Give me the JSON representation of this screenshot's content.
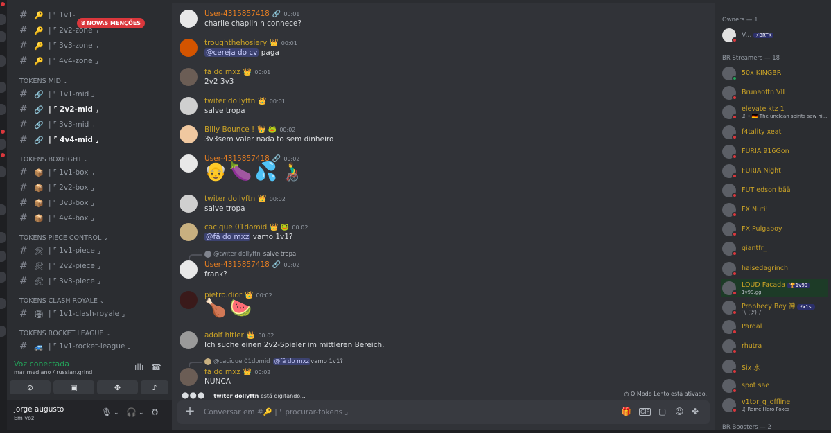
{
  "sidebar": {
    "mentions_pill": "8 NOVAS MENÇÕES",
    "channels_top": [
      {
        "emoji": "🔑",
        "label": "| ⌜ 1v1-"
      },
      {
        "emoji": "🔑",
        "label": "| ⌜ 2v2-zone ⌟"
      },
      {
        "emoji": "🔑",
        "label": "| ⌜ 3v3-zone ⌟"
      },
      {
        "emoji": "🔑",
        "label": "| ⌜ 4v4-zone ⌟"
      }
    ],
    "categories": [
      {
        "name": "TOKENS MID",
        "channels": [
          {
            "emoji": "🔗",
            "label": "| ⌜ 1v1-mid ⌟",
            "unread": false
          },
          {
            "emoji": "🔗",
            "label": "| ⌜ 2v2-mid ⌟",
            "unread": true
          },
          {
            "emoji": "🔗",
            "label": "| ⌜ 3v3-mid ⌟",
            "unread": false
          },
          {
            "emoji": "🔗",
            "label": "| ⌜ 4v4-mid ⌟",
            "unread": true
          }
        ]
      },
      {
        "name": "TOKENS BOXFIGHT",
        "channels": [
          {
            "emoji": "📦",
            "label": "| ⌜ 1v1-box ⌟",
            "unread": false
          },
          {
            "emoji": "📦",
            "label": "| ⌜ 2v2-box ⌟",
            "unread": false
          },
          {
            "emoji": "📦",
            "label": "| ⌜ 3v3-box ⌟",
            "unread": false
          },
          {
            "emoji": "📦",
            "label": "| ⌜ 4v4-box ⌟",
            "unread": false
          }
        ]
      },
      {
        "name": "TOKENS PIECE CONTROL",
        "channels": [
          {
            "emoji": "🛠",
            "label": "| ⌜ 1v1-piece ⌟",
            "unread": false
          },
          {
            "emoji": "🛠",
            "label": "| ⌜ 2v2-piece ⌟",
            "unread": false
          },
          {
            "emoji": "🛠",
            "label": "| ⌜ 3v3-piece ⌟",
            "unread": false
          }
        ]
      },
      {
        "name": "TOKENS CLASH ROYALE",
        "channels": [
          {
            "emoji": "🏟",
            "label": "| ⌜ 1v1-clash-royale ⌟",
            "unread": false
          }
        ]
      },
      {
        "name": "TOKENS ROCKET LEAGUE",
        "channels": [
          {
            "emoji": "🚙",
            "label": "| ⌜ 1v1-rocket-league ⌟",
            "unread": false
          }
        ]
      }
    ],
    "voice": {
      "title": "Voz conectada",
      "subtitle": "mar mediano / russian.grind"
    },
    "user": {
      "name": "jorge augusto",
      "status": "Em voz"
    }
  },
  "chat": {
    "messages": [
      {
        "author": "User-4315857418",
        "color": "#e67e22",
        "tag": "🔗",
        "time": "00:01",
        "body": "charlie chaplin n conhece?"
      },
      {
        "author": "troughthehosiery",
        "color": "#c9a227",
        "tag": "👑",
        "time": "00:01",
        "mention": "@cereja do cv",
        "body": " paga"
      },
      {
        "author": "fã do mxz",
        "color": "#c9a227",
        "tag": "👑",
        "time": "00:01",
        "body": "2v2 3v3"
      },
      {
        "author": "twiter dollyftn",
        "color": "#c9a227",
        "tag": "👑",
        "time": "00:01",
        "body": "salve tropa"
      },
      {
        "author": "Billy Bounce !",
        "color": "#c9a227",
        "tag": "👑 🐸",
        "time": "00:02",
        "body": "3v3sem valer nada to sem dinheiro"
      },
      {
        "author": "User-4315857418",
        "color": "#e67e22",
        "tag": "🔗",
        "time": "00:02",
        "body": "👴🍆💦👨‍🦽"
      },
      {
        "author": "twiter dollyftn",
        "color": "#c9a227",
        "tag": "👑",
        "time": "00:02",
        "body": "salve tropa"
      },
      {
        "author": "cacique 01domid",
        "color": "#c9a227",
        "tag": "👑 🐸",
        "time": "00:02",
        "mention": "@fã do mxz",
        "body": " vamo 1v1?"
      },
      {
        "reply_name": "@twiter dollyftn",
        "reply_text": "salve tropa",
        "author": "User-4315857418",
        "color": "#e67e22",
        "tag": "🔗",
        "time": "00:02",
        "body": "frank?"
      },
      {
        "author": "pietro.dior",
        "color": "#c9a227",
        "tag": "👑",
        "time": "00:02",
        "body": "🍗🍉"
      },
      {
        "author": "adolf hitler",
        "color": "#c9a227",
        "tag": "👑",
        "time": "00:02",
        "body": "Ich suche einen 2v2-Spieler im mittleren Bereich."
      },
      {
        "reply_name": "@cacique 01domid",
        "reply_mention": "@fã do mxz",
        "reply_text": " vamo 1v1?",
        "author": "fã do mxz",
        "color": "#c9a227",
        "tag": "👑",
        "time": "00:02",
        "body": "NUNCA"
      }
    ],
    "typing": {
      "user": "twiter dollyftn",
      "text": " está digitando..."
    },
    "slowmode": "O Modo Lento está ativado.",
    "composer": {
      "placeholder": "Conversar em #🔑 | ⌜ procurar-tokens ⌟"
    }
  },
  "members": {
    "groups": [
      {
        "label": "Owners — 1",
        "members": [
          {
            "name": "V...",
            "badge": "⚡BRTK",
            "color": "#949ba4",
            "online": false
          }
        ]
      },
      {
        "label": "BR Streamers — 18",
        "members": [
          {
            "name": "50x KINGBR",
            "color": "#c9a227",
            "online": true
          },
          {
            "name": "Brunaoftn VII",
            "color": "#c9a227",
            "online": false
          },
          {
            "name": "elevate ktz 1",
            "color": "#c9a227",
            "online": false,
            "sub": "♫ • 🇩🇪 The unclean spirits saw hi..."
          },
          {
            "name": "f4tality xeat",
            "color": "#c9a227",
            "online": false
          },
          {
            "name": "FURIA 916Gon",
            "color": "#c9a227",
            "online": false
          },
          {
            "name": "FURIA Night",
            "color": "#c9a227",
            "online": false
          },
          {
            "name": "FUT edson bãã",
            "color": "#c9a227",
            "online": false
          },
          {
            "name": "FX Nuti!",
            "color": "#c9a227",
            "online": false
          },
          {
            "name": "FX Pulgaboy",
            "color": "#c9a227",
            "online": false
          },
          {
            "name": "giantfr_",
            "color": "#c9a227",
            "online": false
          },
          {
            "name": "haisedagrinch",
            "color": "#c9a227",
            "online": false
          },
          {
            "name": "LOUD Facada",
            "color": "#c9a227",
            "online": false,
            "badge": "🏆1v99",
            "sub": "1v99.gg"
          },
          {
            "name": "Prophecy Boy 神",
            "color": "#c9a227",
            "online": false,
            "badge": "⚡x1st",
            "sub": "¯\\_(ツ)_/¯"
          },
          {
            "name": "Pardal",
            "color": "#c9a227",
            "online": false
          },
          {
            "name": "rhutra",
            "color": "#c9a227",
            "online": false
          },
          {
            "name": "Six 水",
            "color": "#c9a227",
            "online": false
          },
          {
            "name": "spot sae",
            "color": "#c9a227",
            "online": false
          },
          {
            "name": "v1tor_g_offline",
            "color": "#c9a227",
            "online": false,
            "sub": "♫ Rome Hero Foxes"
          }
        ]
      },
      {
        "label": "BR Boosters — 2",
        "members": []
      }
    ]
  },
  "colors": {
    "online": "#23a55a",
    "dnd": "#da373c",
    "accent": "#5865f2"
  }
}
